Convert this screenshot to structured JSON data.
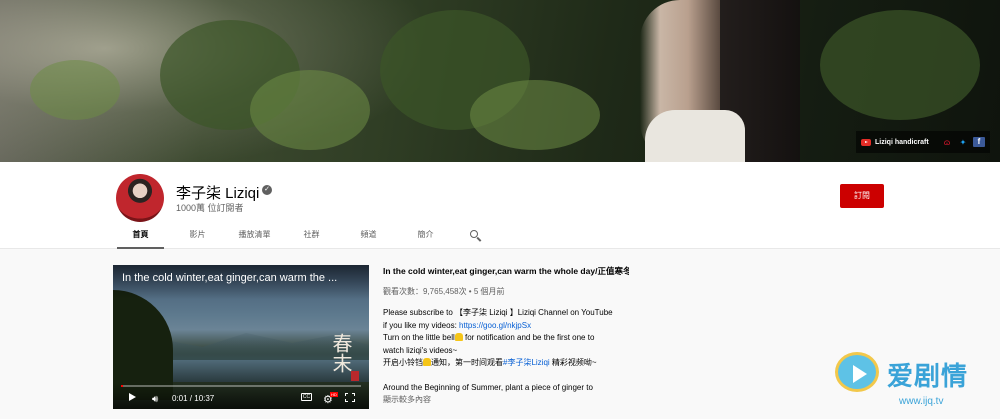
{
  "banner": {
    "links_label": "Liziqi handicraft",
    "icons": [
      "youtube-icon",
      "weibo-icon",
      "twitter-icon",
      "facebook-icon"
    ]
  },
  "channel": {
    "name": "李子柒 Liziqi",
    "subscribers": "1000萬 位訂閱者",
    "subscribe_label": "訂閱"
  },
  "tabs": [
    {
      "label": "首頁",
      "active": true
    },
    {
      "label": "影片"
    },
    {
      "label": "播放清單"
    },
    {
      "label": "社群"
    },
    {
      "label": "頻道"
    },
    {
      "label": "簡介"
    }
  ],
  "player": {
    "overlay_title": "In the cold winter,eat ginger,can warm the ...",
    "calligraphy": "春末",
    "time": "0:01 / 10:37",
    "progress": 0.002
  },
  "video": {
    "title": "In the cold winter,eat ginger,can warm the whole day/正值寒冬...",
    "meta": "觀看次數：9,765,458次 • 5 個月前",
    "desc_line1": "Please subscribe to 【李子柒 Liziqi 】Liziqi Channel on YouTube",
    "desc_line2_prefix": "if you like my videos: ",
    "desc_link": "https://goo.gl/nkjpSx",
    "desc_line3a": "Turn on the little bell",
    "desc_line3b": "  for notification and be the first one to",
    "desc_line4": "watch liziqi's videos~",
    "desc_line5a": "开启小铃铛",
    "desc_line5b": "通知，第一时间观看",
    "desc_hashtag": "#李子柒Liziqi",
    "desc_line5c": " 精彩视频呦~",
    "desc_line6": "Around the Beginning of Summer, plant a piece of ginger to",
    "more_label": "顯示較多內容"
  },
  "watermark": {
    "brand": "爱剧情",
    "url": "www.ijq.tv"
  }
}
